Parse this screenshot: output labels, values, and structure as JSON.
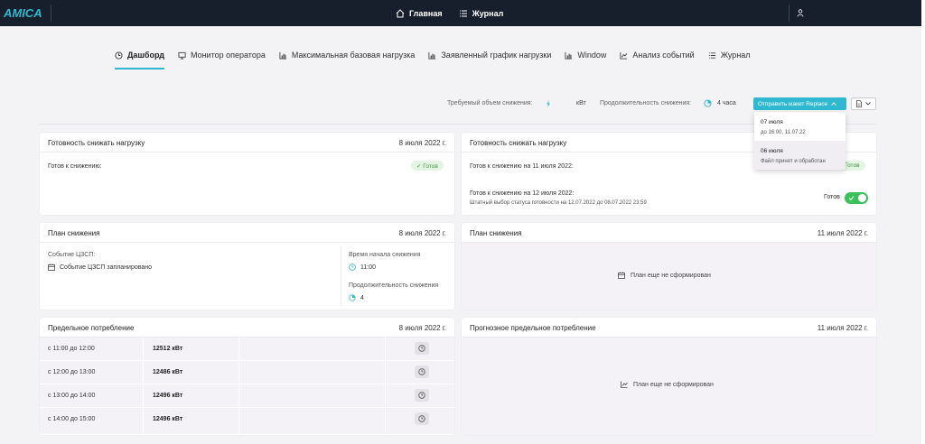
{
  "topbar": {
    "logo_text": "AMICA",
    "nav": [
      {
        "label": "Главная",
        "icon": "home-icon"
      },
      {
        "label": "Журнал",
        "icon": "list-icon"
      }
    ]
  },
  "tabs": [
    {
      "label": "Дашборд",
      "icon": "clock-icon",
      "active": true
    },
    {
      "label": "Монитор оператора",
      "icon": "monitor-icon"
    },
    {
      "label": "Максимальная базовая нагрузка",
      "icon": "bar-chart-icon"
    },
    {
      "label": "Заявленный график нагрузки",
      "icon": "bar-chart-icon"
    },
    {
      "label": "Window",
      "icon": "bar-chart-icon"
    },
    {
      "label": "Анализ событий",
      "icon": "line-chart-icon"
    },
    {
      "label": "Журнал",
      "icon": "list-icon"
    }
  ],
  "filter": {
    "reduction_label": "Требуемый объем снижения:",
    "reduction_unit": "кВт",
    "duration_label": "Продолжительность снижения:",
    "duration_value": "4 часа",
    "send_button": "Отправить макет Replace"
  },
  "dropdown": {
    "items": [
      {
        "title": "07 июля",
        "sub": "до 16:00, 11.07.22"
      },
      {
        "title": "06 июля",
        "sub": "Файл принят и обработан"
      }
    ]
  },
  "readiness_left": {
    "title": "Готовность снижать нагрузку",
    "date": "8 июля 2022 г.",
    "ready_label": "Готов к снижению:",
    "badge": "✓ Готов"
  },
  "readiness_right": {
    "title": "Готовность снижать нагрузку",
    "row1_label": "Готов к снижению на 11 июля 2022:",
    "row1_badge": "Готов",
    "row2_label": "Готов к снижению на 12 июля 2022:",
    "row2_sub": "Штатный выбор статуса готовности на 12.07.2022 до 08.07.2022 23:59",
    "row2_status": "Готов"
  },
  "plan_left": {
    "title": "План снижения",
    "date": "8 июля 2022 г.",
    "event_label": "Событие ЦЗСП:",
    "event_value": "Событие ЦЗСП запланировано",
    "start_label": "Время начала снижения",
    "start_value": "11:00",
    "duration_label": "Продолжительность снижения",
    "duration_value": "4"
  },
  "plan_right": {
    "title": "План снижения",
    "date": "11 июля 2022 г.",
    "placeholder": "План еще не сформирован"
  },
  "limit_left": {
    "title": "Предельное потребление",
    "date": "8 июля 2022 г.",
    "rows": [
      {
        "period": "с 11:00 до 12:00",
        "value": "12512 кВт"
      },
      {
        "period": "с 12:00 до 13:00",
        "value": "12486 кВт"
      },
      {
        "period": "с 13:00 до 14:00",
        "value": "12496 кВт"
      },
      {
        "period": "с 14:00 до 15:00",
        "value": "12496 кВт"
      }
    ]
  },
  "limit_right": {
    "title": "Прогнозное предельное потребление",
    "date": "11 июля 2022 г.",
    "placeholder": "План еще не сформирован"
  },
  "colors": {
    "topbar": "#171f2c",
    "accent": "#2fb8cf",
    "success": "#3cc05a"
  }
}
